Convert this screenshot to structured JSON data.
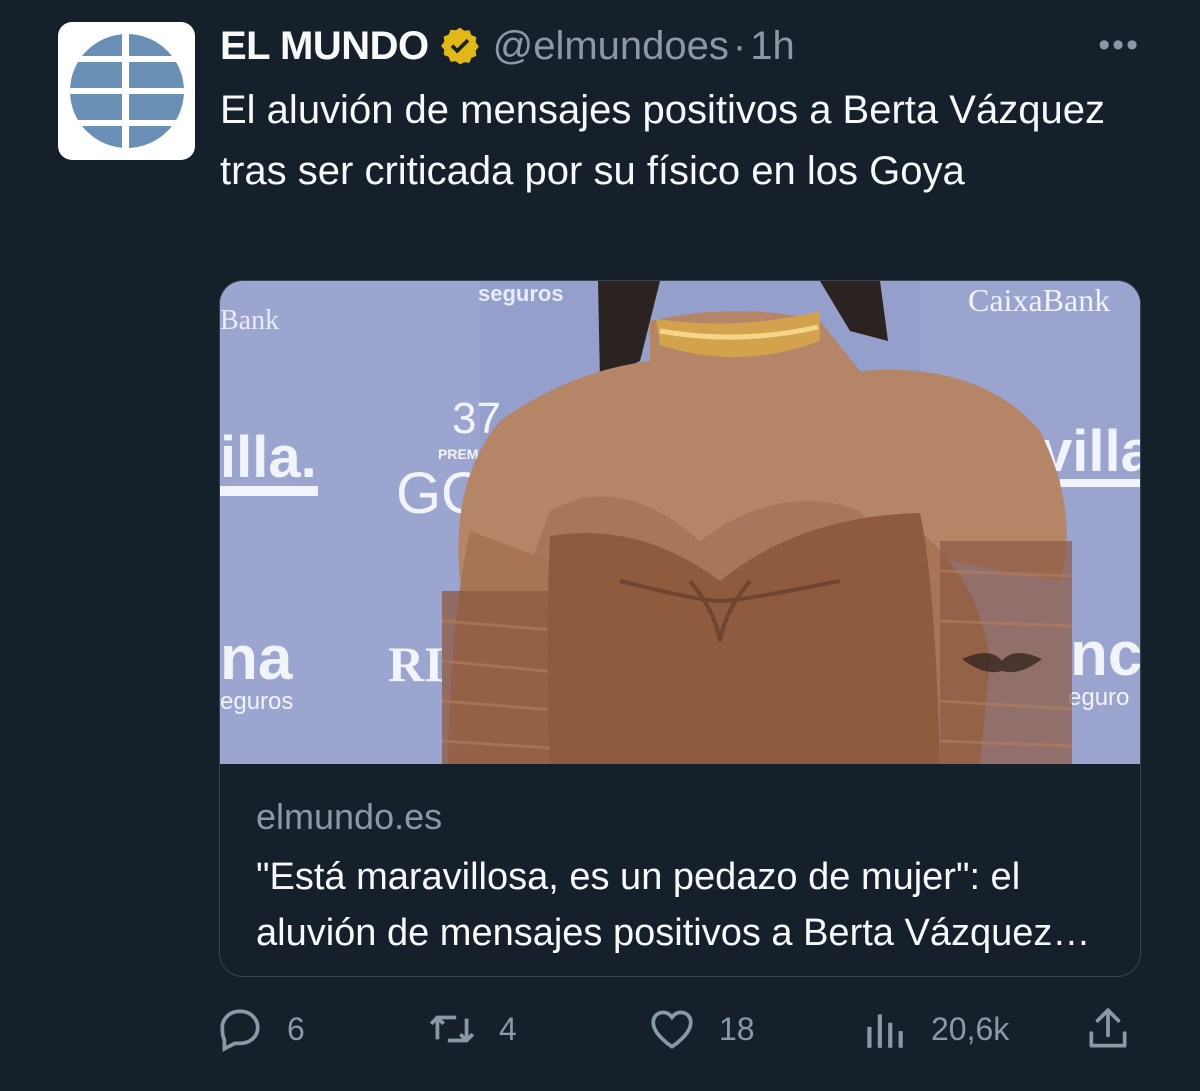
{
  "author": {
    "name": "EL MUNDO",
    "handle": "@elmundoes",
    "separator": "·",
    "time": "1h",
    "verified": true,
    "avatar_icon": "el-mundo-globe-logo"
  },
  "tweet": {
    "text": "El aluvión de mensajes positivos a Berta Vázquez tras ser criticada por su físico en los Goya"
  },
  "card": {
    "domain": "elmundo.es",
    "title": "\"Está maravillosa, es un pedazo de mujer\": el aluvión de mensajes positivos a Berta Vázquez tras ser criticada por su físico en los Goya",
    "image_backdrop_text": {
      "bank_left": "Bank",
      "seguros_top": "seguros",
      "caixabank": "CaixaBank",
      "illa_left": "illa.",
      "num_37": "37",
      "premios": "PREM",
      "goya_partial": "GO",
      "villa_right": "villa",
      "na_left": "na",
      "seguros_left": "eguros",
      "ri": "RI",
      "nc_right": "nc",
      "seguros_right": "eguro"
    }
  },
  "actions": {
    "replies": "6",
    "retweets": "4",
    "likes": "18",
    "views": "20,6k"
  },
  "colors": {
    "background": "#15202b",
    "secondary_text": "#8b98a5",
    "verified_gold": "#e2b719",
    "logo_blue": "#6a8fb5"
  }
}
